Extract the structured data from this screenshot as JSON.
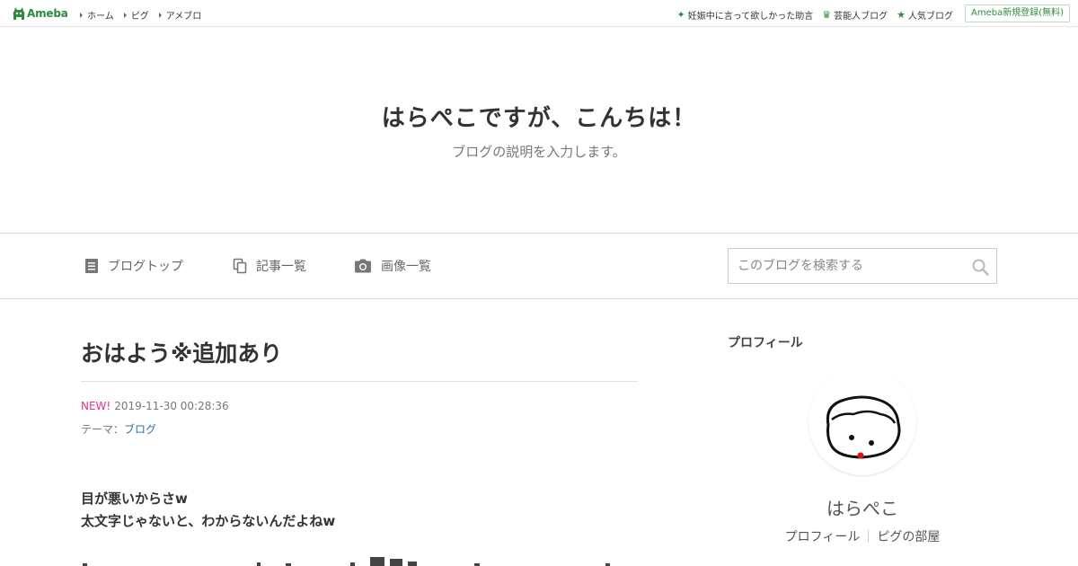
{
  "header": {
    "logo_text": "Ameba",
    "nav": [
      {
        "label": "ホーム"
      },
      {
        "label": "ピグ"
      },
      {
        "label": "アメブロ"
      }
    ],
    "right_links": [
      {
        "label": "妊娠中に言って欲しかった助言",
        "icon": "sparkle-icon"
      },
      {
        "label": "芸能人ブログ",
        "icon": "crown-icon"
      },
      {
        "label": "人気ブログ",
        "icon": "star-icon"
      }
    ],
    "signup_label": "Ameba新規登録(無料)",
    "accent_color": "#2d8c3c"
  },
  "blog": {
    "title": "はらぺこですが、こんちは！",
    "description": "ブログの説明を入力します。"
  },
  "nav": {
    "blog_top": "ブログトップ",
    "entry_list": "記事一覧",
    "image_list": "画像一覧",
    "search_placeholder": "このブログを検索する"
  },
  "article": {
    "title": "おはよう※追加あり",
    "new_label": "NEW!",
    "datetime": "2019-11-30 00:28:36",
    "theme_prefix": "テーマ：",
    "theme": "ブログ",
    "lines": [
      "目が悪いからさw",
      "太文字じゃないと、わからないんだよねw"
    ]
  },
  "sidebar": {
    "profile_title": "プロフィール",
    "name": "はらぺこ",
    "links": [
      {
        "label": "プロフィール"
      },
      {
        "label": "ピグの部屋"
      }
    ]
  }
}
